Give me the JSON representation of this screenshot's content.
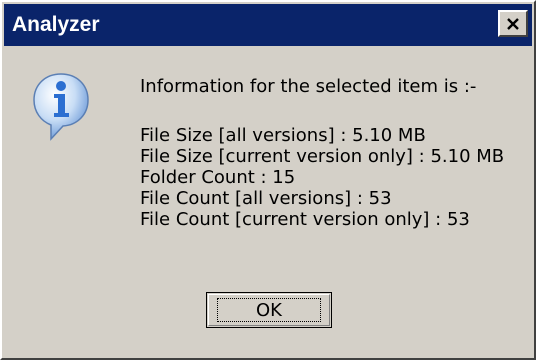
{
  "window": {
    "title": "Analyzer"
  },
  "icons": {
    "dialog_icon": "information-icon",
    "close_icon": "close-icon"
  },
  "message": {
    "heading": "Information for the selected item is :-",
    "lines": [
      "File Size [all versions] : 5.10 MB",
      "File Size [current version only] : 5.10 MB",
      "Folder Count : 15",
      "File Count [all versions] : 53",
      "File Count [current version only] : 53"
    ]
  },
  "buttons": {
    "ok_label": "OK"
  },
  "colors": {
    "titlebar": "#0a246a",
    "dialog_bg": "#d4d0c8",
    "icon_blue": "#2c6fd1"
  }
}
